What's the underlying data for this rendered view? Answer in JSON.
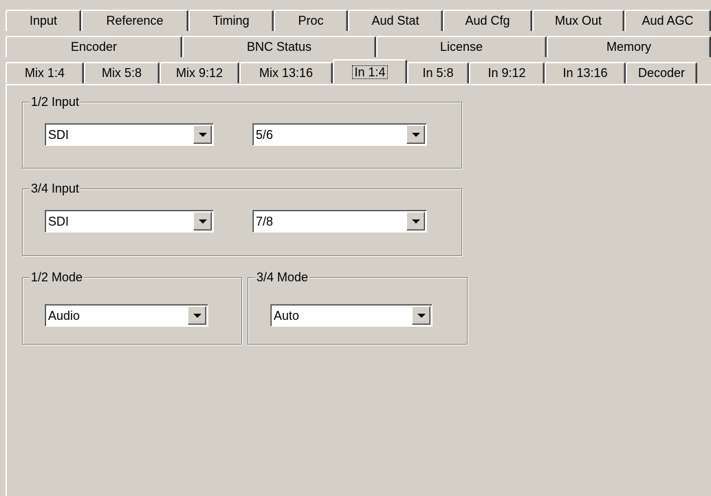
{
  "tabs": {
    "row1": [
      "Input",
      "Reference",
      "Timing",
      "Proc",
      "Aud Stat",
      "Aud Cfg",
      "Mux Out",
      "Aud AGC"
    ],
    "row2": [
      "Encoder",
      "BNC Status",
      "License",
      "Memory"
    ],
    "row3": [
      "Mix 1:4",
      "Mix 5:8",
      "Mix 9:12",
      "Mix 13:16",
      "In 1:4",
      "In 5:8",
      "In 9:12",
      "In 13:16",
      "Decoder"
    ],
    "active": "In 1:4"
  },
  "groups": {
    "input12": {
      "title": "1/2 Input",
      "combo_a": "SDI",
      "combo_b": "5/6"
    },
    "input34": {
      "title": "3/4 Input",
      "combo_a": "SDI",
      "combo_b": "7/8"
    },
    "mode12": {
      "title": "1/2 Mode",
      "combo": "Audio"
    },
    "mode34": {
      "title": "3/4 Mode",
      "combo": "Auto"
    }
  }
}
